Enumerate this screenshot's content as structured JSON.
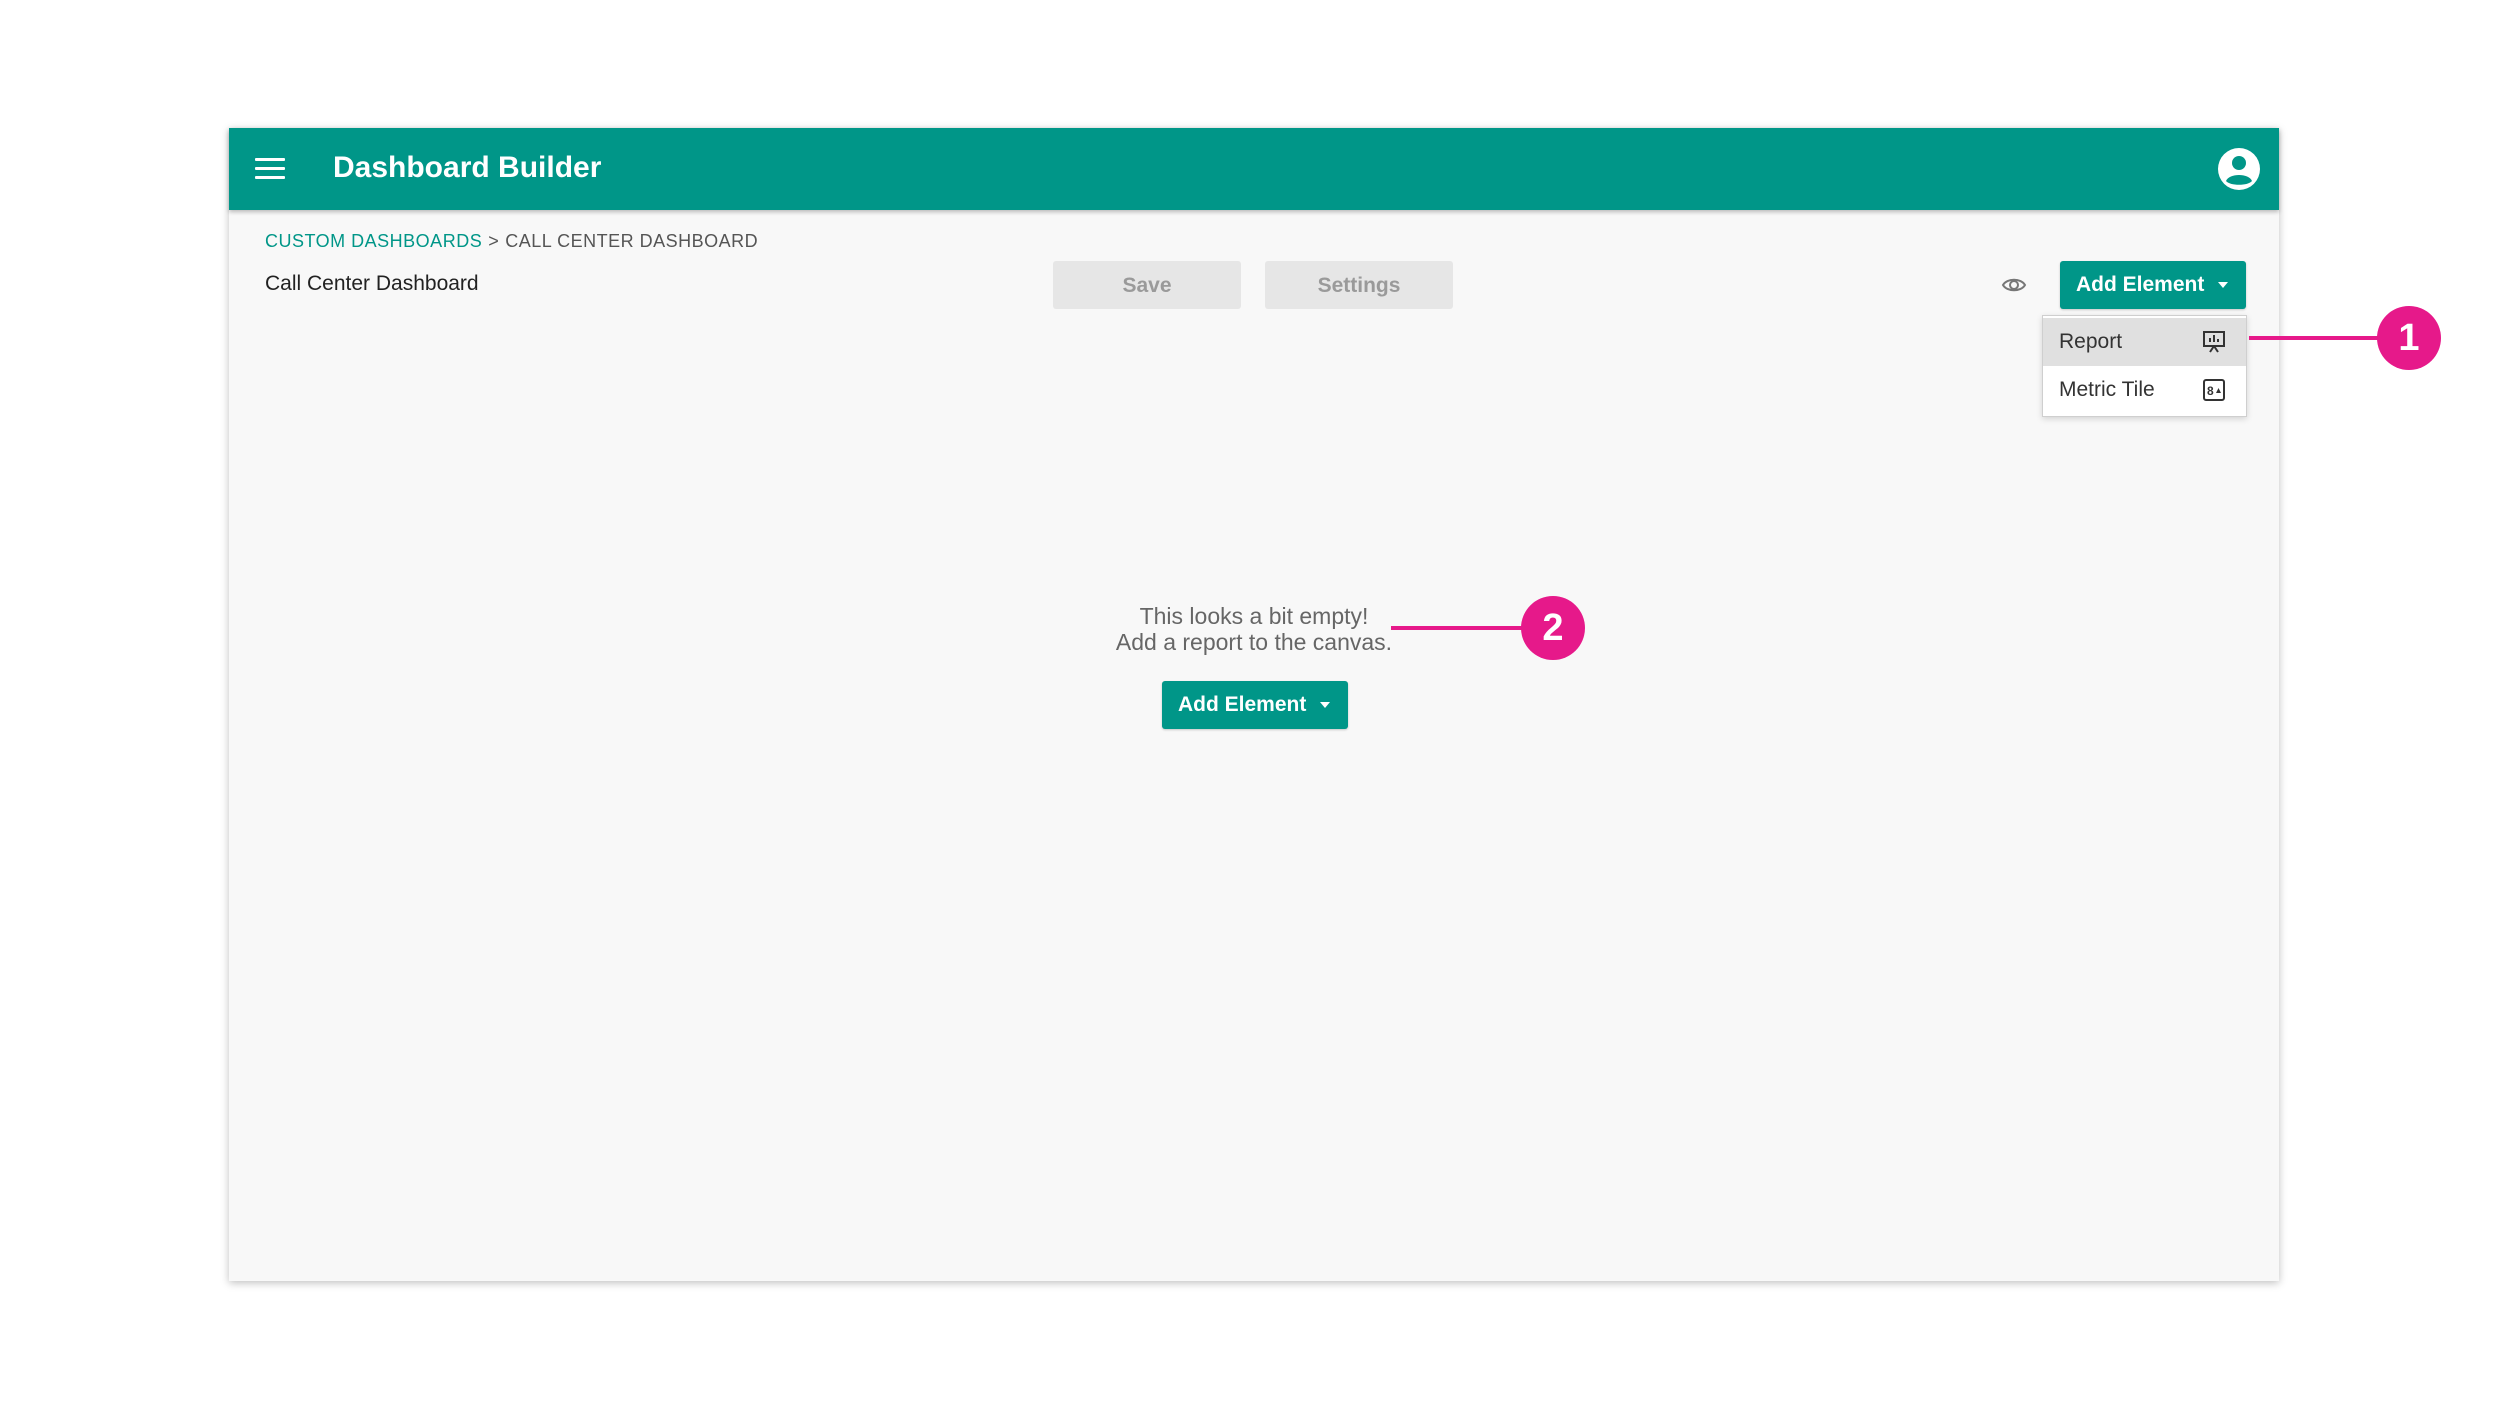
{
  "app": {
    "title": "Dashboard Builder"
  },
  "breadcrumb": {
    "parent": "CUSTOM DASHBOARDS",
    "separator": ">",
    "current": "CALL CENTER DASHBOARD"
  },
  "page": {
    "title": "Call Center Dashboard"
  },
  "toolbar": {
    "save_label": "Save",
    "settings_label": "Settings",
    "add_element_label": "Add Element"
  },
  "dropdown": {
    "items": [
      {
        "label": "Report",
        "icon": "presentation-chart-icon"
      },
      {
        "label": "Metric Tile",
        "icon": "metric-tile-icon"
      }
    ]
  },
  "empty_state": {
    "line1": "This looks a bit empty!",
    "line2": "Add a report to the canvas.",
    "button_label": "Add Element"
  },
  "annotations": {
    "badge1": "1",
    "badge2": "2"
  },
  "colors": {
    "primary": "#009688",
    "annotation": "#e6198a",
    "canvas": "#f8f8f8"
  }
}
